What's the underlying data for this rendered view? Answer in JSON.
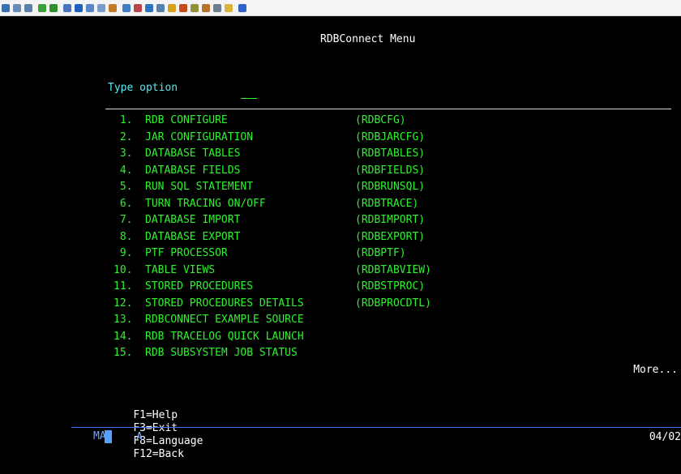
{
  "toolbar": {
    "icons": [
      {
        "name": "display-icon",
        "color": "#3a6fb0"
      },
      {
        "name": "copy-icon",
        "color": "#6b8bb8"
      },
      {
        "name": "paste-icon",
        "color": "#5a7fa8"
      },
      {
        "name": "upload-icon",
        "color": "#3aa13a"
      },
      {
        "name": "download-icon",
        "color": "#2f8f2f"
      },
      {
        "name": "document-icon",
        "color": "#4a76c0"
      },
      {
        "name": "record-icon",
        "color": "#1f5fbf"
      },
      {
        "name": "window-icon",
        "color": "#5a86c8"
      },
      {
        "name": "list-icon",
        "color": "#7a9ccf"
      },
      {
        "name": "macro-icon",
        "color": "#c27b28"
      },
      {
        "name": "database-icon",
        "color": "#3f7fc4"
      },
      {
        "name": "chart-icon",
        "color": "#b8434b"
      },
      {
        "name": "grid-icon",
        "color": "#2e72c2"
      },
      {
        "name": "keyboard-icon",
        "color": "#5680b0"
      },
      {
        "name": "tools-icon",
        "color": "#d4a21a"
      },
      {
        "name": "user-icon",
        "color": "#c94c1d"
      },
      {
        "name": "print-icon",
        "color": "#8f8f3a"
      },
      {
        "name": "transfer-icon",
        "color": "#b8722a"
      },
      {
        "name": "network-icon",
        "color": "#6b7f8f"
      },
      {
        "name": "note-icon",
        "color": "#d8b43a"
      },
      {
        "name": "help-icon",
        "color": "#2d62c8"
      }
    ]
  },
  "screen": {
    "title": "RDBConnect Menu",
    "type_option_label": "Type option",
    "more_label": "More...",
    "menu": [
      {
        "num": " 1.",
        "label": "RDB CONFIGURE",
        "cmd": "(RDBCFG)"
      },
      {
        "num": " 2.",
        "label": "JAR CONFIGURATION",
        "cmd": "(RDBJARCFG)"
      },
      {
        "num": " 3.",
        "label": "DATABASE TABLES",
        "cmd": "(RDBTABLES)"
      },
      {
        "num": " 4.",
        "label": "DATABASE FIELDS",
        "cmd": "(RDBFIELDS)"
      },
      {
        "num": " 5.",
        "label": "RUN SQL STATEMENT",
        "cmd": "(RDBRUNSQL)"
      },
      {
        "num": " 6.",
        "label": "TURN TRACING ON/OFF",
        "cmd": "(RDBTRACE)"
      },
      {
        "num": " 7.",
        "label": "DATABASE IMPORT",
        "cmd": "(RDBIMPORT)"
      },
      {
        "num": " 8.",
        "label": "DATABASE EXPORT",
        "cmd": "(RDBEXPORT)"
      },
      {
        "num": " 9.",
        "label": "PTF PROCESSOR",
        "cmd": "(RDBPTF)"
      },
      {
        "num": "10.",
        "label": "TABLE VIEWS",
        "cmd": "(RDBTABVIEW)"
      },
      {
        "num": "11.",
        "label": "STORED PROCEDURES",
        "cmd": "(RDBSTPROC)"
      },
      {
        "num": "12.",
        "label": "STORED PROCEDURES DETAILS",
        "cmd": "(RDBPROCDTL)"
      },
      {
        "num": "13.",
        "label": "RDBCONNECT EXAMPLE SOURCE",
        "cmd": ""
      },
      {
        "num": "14.",
        "label": "RDB TRACELOG QUICK LAUNCH",
        "cmd": ""
      },
      {
        "num": "15.",
        "label": "RDB SUBSYSTEM JOB STATUS",
        "cmd": ""
      }
    ],
    "function_keys": [
      "F1=Help",
      "F3=Exit",
      "F8=Language",
      "F12=Back"
    ]
  },
  "status_bar": {
    "mode": "MA",
    "indicator": "A",
    "date": "04/02"
  },
  "colors": {
    "background": "#000000",
    "menu_text": "#2df22d",
    "field_text": "#58e9f2",
    "title_text": "#ffffff"
  }
}
